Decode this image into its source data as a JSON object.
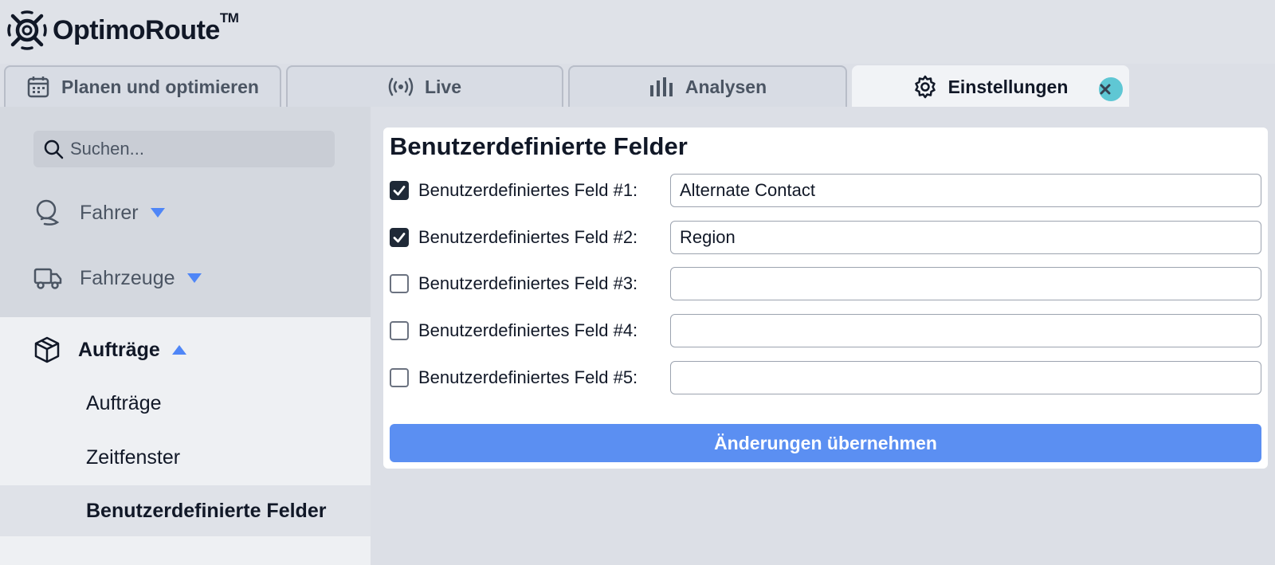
{
  "app": {
    "name": "OptimoRoute",
    "trademark": "TM"
  },
  "tabs": [
    {
      "label": "Planen und optimieren",
      "icon": "calendar-icon"
    },
    {
      "label": "Live",
      "icon": "broadcast-icon"
    },
    {
      "label": "Analysen",
      "icon": "bar-chart-icon"
    },
    {
      "label": "Einstellungen",
      "icon": "gear-icon",
      "active": true,
      "closable": true
    }
  ],
  "sidebar": {
    "search_placeholder": "Suchen...",
    "items": [
      {
        "label": "Fahrer",
        "icon": "driver-icon",
        "expanded": false
      },
      {
        "label": "Fahrzeuge",
        "icon": "truck-icon",
        "expanded": false
      },
      {
        "label": "Aufträge",
        "icon": "package-icon",
        "expanded": true
      }
    ],
    "sub_items": [
      {
        "label": "Aufträge"
      },
      {
        "label": "Zeitfenster"
      },
      {
        "label": "Benutzerdefinierte Felder",
        "selected": true
      }
    ]
  },
  "main": {
    "title": "Benutzerdefinierte Felder",
    "fields": [
      {
        "label": "Benutzerdefiniertes Feld #1:",
        "checked": true,
        "value": "Alternate Contact"
      },
      {
        "label": "Benutzerdefiniertes Feld #2:",
        "checked": true,
        "value": "Region"
      },
      {
        "label": "Benutzerdefiniertes Feld #3:",
        "checked": false,
        "value": ""
      },
      {
        "label": "Benutzerdefiniertes Feld #4:",
        "checked": false,
        "value": ""
      },
      {
        "label": "Benutzerdefiniertes Feld #5:",
        "checked": false,
        "value": ""
      }
    ],
    "submit_label": "Änderungen übernehmen"
  },
  "colors": {
    "accent": "#5b8ff2",
    "caret": "#4f86f7",
    "close": "#5fc7d4",
    "text": "#111827"
  }
}
